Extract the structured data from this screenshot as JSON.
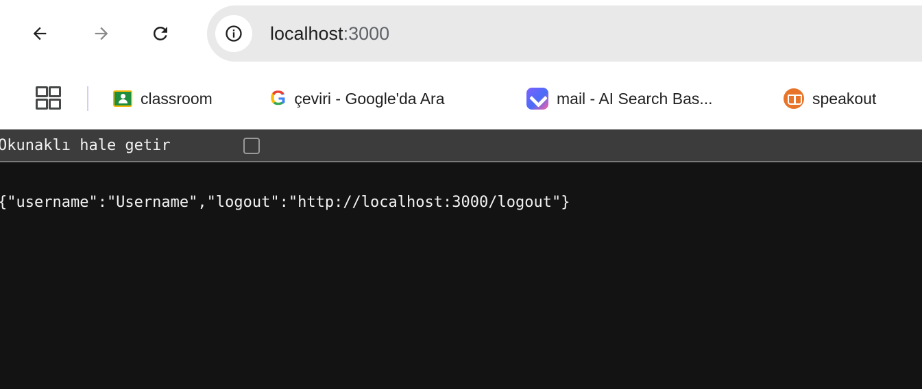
{
  "browser": {
    "omnibox": {
      "url_host": "localhost",
      "url_port": ":3000"
    },
    "nav_icons": {
      "back": "arrow-left-icon",
      "forward": "arrow-right-icon",
      "reload": "reload-icon",
      "site_info": "info-icon"
    }
  },
  "bookmarks": {
    "apps_icon": "apps-grid-icon",
    "items": [
      {
        "label": "classroom",
        "icon": "google-classroom-icon"
      },
      {
        "label": "çeviri - Google'da Ara",
        "icon": "google-g-icon"
      },
      {
        "label": "mail - AI Search Bas...",
        "icon": "ai-search-icon"
      },
      {
        "label": "speakout",
        "icon": "book-icon"
      }
    ]
  },
  "page": {
    "pretty_print_label": "Okunaklı hale getir",
    "pretty_print_checked": false,
    "json_text": "{\"username\":\"Username\",\"logout\":\"http://localhost:3000/logout\"}"
  },
  "colors": {
    "page_background": "#131313",
    "pretty_bar_background": "#3c3c3c",
    "omnibox_background": "#e9e9e9"
  }
}
